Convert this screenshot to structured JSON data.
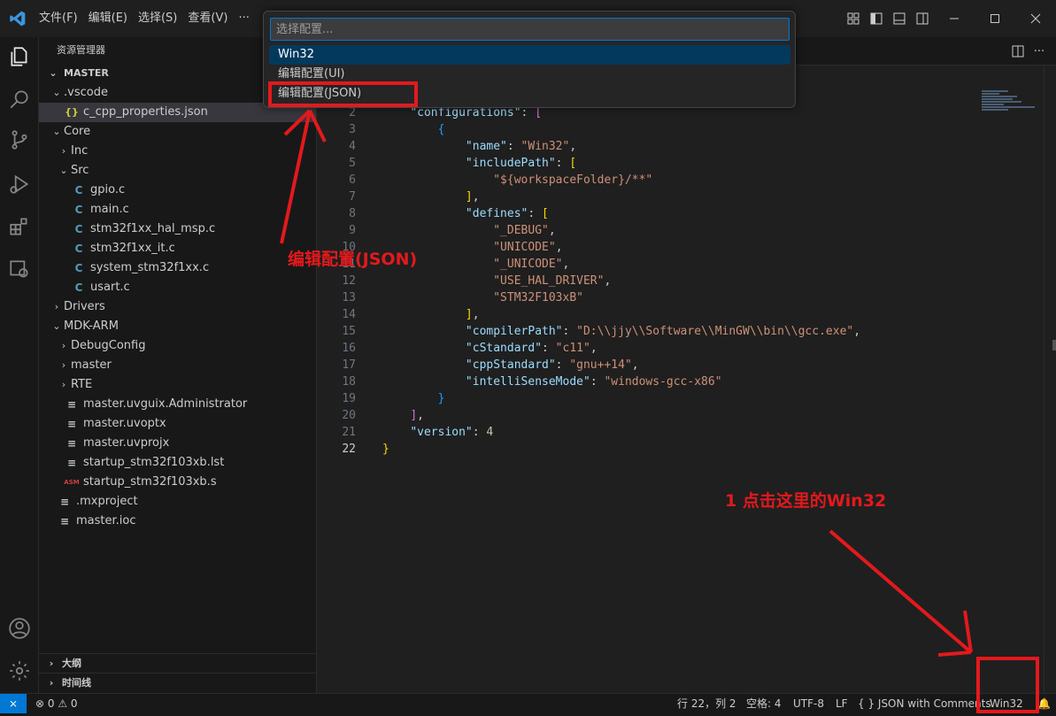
{
  "titlebar": {
    "menu": [
      "文件(F)",
      "编辑(E)",
      "选择(S)",
      "查看(V)",
      "···"
    ],
    "window_controls": [
      "minimize-icon",
      "maximize-icon",
      "close-icon"
    ]
  },
  "sidebar": {
    "title": "资源管理器",
    "root": "MASTER",
    "tree": [
      {
        "label": ".vscode",
        "depth": 1,
        "chevron": "⌄",
        "icon": ""
      },
      {
        "label": "c_cpp_properties.json",
        "depth": 2,
        "chevron": "",
        "icon": "{}",
        "selected": true
      },
      {
        "label": "Core",
        "depth": 1,
        "chevron": "⌄",
        "icon": ""
      },
      {
        "label": "Inc",
        "depth": 2,
        "chevron": "›",
        "icon": ""
      },
      {
        "label": "Src",
        "depth": 2,
        "chevron": "⌄",
        "icon": ""
      },
      {
        "label": "gpio.c",
        "depth": 3,
        "chevron": "",
        "icon": "C"
      },
      {
        "label": "main.c",
        "depth": 3,
        "chevron": "",
        "icon": "C"
      },
      {
        "label": "stm32f1xx_hal_msp.c",
        "depth": 3,
        "chevron": "",
        "icon": "C"
      },
      {
        "label": "stm32f1xx_it.c",
        "depth": 3,
        "chevron": "",
        "icon": "C"
      },
      {
        "label": "system_stm32f1xx.c",
        "depth": 3,
        "chevron": "",
        "icon": "C"
      },
      {
        "label": "usart.c",
        "depth": 3,
        "chevron": "",
        "icon": "C"
      },
      {
        "label": "Drivers",
        "depth": 1,
        "chevron": "›",
        "icon": ""
      },
      {
        "label": "MDK-ARM",
        "depth": 1,
        "chevron": "⌄",
        "icon": ""
      },
      {
        "label": "DebugConfig",
        "depth": 2,
        "chevron": "›",
        "icon": ""
      },
      {
        "label": "master",
        "depth": 2,
        "chevron": "›",
        "icon": ""
      },
      {
        "label": "RTE",
        "depth": 2,
        "chevron": "›",
        "icon": ""
      },
      {
        "label": "master.uvguix.Administrator",
        "depth": 2,
        "chevron": "",
        "icon": "≡"
      },
      {
        "label": "master.uvoptx",
        "depth": 2,
        "chevron": "",
        "icon": "≡"
      },
      {
        "label": "master.uvprojx",
        "depth": 2,
        "chevron": "",
        "icon": "≡"
      },
      {
        "label": "startup_stm32f103xb.lst",
        "depth": 2,
        "chevron": "",
        "icon": "≡"
      },
      {
        "label": "startup_stm32f103xb.s",
        "depth": 2,
        "chevron": "",
        "icon": "ASM"
      },
      {
        "label": ".mxproject",
        "depth": 1,
        "chevron": "",
        "icon": "≡"
      },
      {
        "label": "master.ioc",
        "depth": 1,
        "chevron": "",
        "icon": "≡"
      }
    ],
    "outline": "大纲",
    "timeline": "时间线"
  },
  "quickpick": {
    "placeholder": "选择配置...",
    "items": [
      "Win32",
      "编辑配置(UI)",
      "编辑配置(JSON)"
    ]
  },
  "editor": {
    "lines": [
      {
        "n": 2,
        "html": "<span class='p'>    </span><span class='k'>\"configurations\"</span><span class='p'>: </span><span class='b2'>[</span>"
      },
      {
        "n": 3,
        "html": "<span class='p'>        </span><span class='b3'>{</span>"
      },
      {
        "n": 4,
        "html": "<span class='p'>            </span><span class='k'>\"name\"</span><span class='p'>: </span><span class='s'>\"Win32\"</span><span class='p'>,</span>"
      },
      {
        "n": 5,
        "html": "<span class='p'>            </span><span class='k'>\"includePath\"</span><span class='p'>: </span><span class='b1'>[</span>"
      },
      {
        "n": 6,
        "html": "<span class='p'>                </span><span class='s'>\"${workspaceFolder}/**\"</span>"
      },
      {
        "n": 7,
        "html": "<span class='p'>            </span><span class='b1'>]</span><span class='p'>,</span>"
      },
      {
        "n": 8,
        "html": "<span class='p'>            </span><span class='k'>\"defines\"</span><span class='p'>: </span><span class='b1'>[</span>"
      },
      {
        "n": 9,
        "html": "<span class='p'>                </span><span class='s'>\"_DEBUG\"</span><span class='p'>,</span>"
      },
      {
        "n": 10,
        "html": "<span class='p'>                </span><span class='s'>\"UNICODE\"</span><span class='p'>,</span>"
      },
      {
        "n": 11,
        "html": "<span class='p'>                </span><span class='s'>\"_UNICODE\"</span><span class='p'>,</span>"
      },
      {
        "n": 12,
        "html": "<span class='p'>                </span><span class='s'>\"USE_HAL_DRIVER\"</span><span class='p'>,</span>"
      },
      {
        "n": 13,
        "html": "<span class='p'>                </span><span class='s'>\"STM32F103xB\"</span>"
      },
      {
        "n": 14,
        "html": "<span class='p'>            </span><span class='b1'>]</span><span class='p'>,</span>"
      },
      {
        "n": 15,
        "html": "<span class='p'>            </span><span class='k'>\"compilerPath\"</span><span class='p'>: </span><span class='s'>\"D:\\\\jjy\\\\Software\\\\MinGW\\\\bin\\\\gcc.exe\"</span><span class='p'>,</span>"
      },
      {
        "n": 16,
        "html": "<span class='p'>            </span><span class='k'>\"cStandard\"</span><span class='p'>: </span><span class='s'>\"c11\"</span><span class='p'>,</span>"
      },
      {
        "n": 17,
        "html": "<span class='p'>            </span><span class='k'>\"cppStandard\"</span><span class='p'>: </span><span class='s'>\"gnu++14\"</span><span class='p'>,</span>"
      },
      {
        "n": 18,
        "html": "<span class='p'>            </span><span class='k'>\"intelliSenseMode\"</span><span class='p'>: </span><span class='s'>\"windows-gcc-x86\"</span>"
      },
      {
        "n": 19,
        "html": "<span class='p'>        </span><span class='b3'>}</span>"
      },
      {
        "n": 20,
        "html": "<span class='p'>    </span><span class='b2'>]</span><span class='p'>,</span>"
      },
      {
        "n": 21,
        "html": "<span class='p'>    </span><span class='k'>\"version\"</span><span class='p'>: </span><span class='n'>4</span>"
      },
      {
        "n": 22,
        "html": "<span class='b1'>}</span>",
        "current": true
      }
    ]
  },
  "annotations": {
    "menu_label": "编辑配置(JSON)",
    "status_label": "1 点击这里的Win32",
    "color": "#e3191c"
  },
  "statusbar": {
    "problems": "⊗ 0 ⚠ 0",
    "position": "行 22，列 2",
    "spaces": "空格: 4",
    "encoding": "UTF-8",
    "eol": "LF",
    "language": "{ } JSON with Comments",
    "config": "Win32"
  },
  "colors": {
    "accent": "#0078d4",
    "quickpick_selected": "#04395e"
  }
}
